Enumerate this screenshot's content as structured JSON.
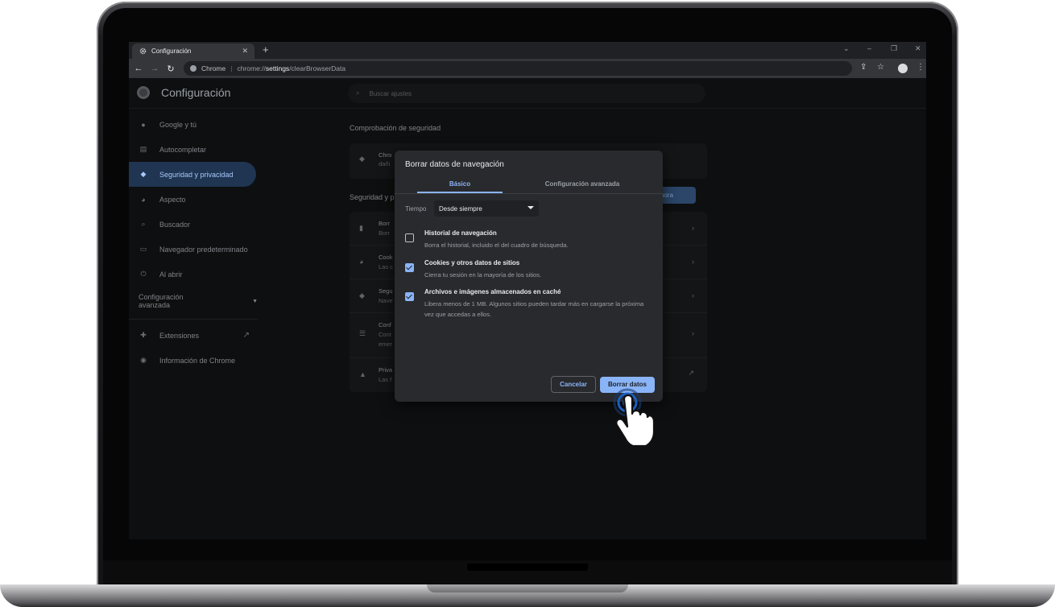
{
  "browser": {
    "tab_title": "Configuración",
    "tab_icon": "gear-icon",
    "tab_close": "✕",
    "new_tab": "+",
    "url_site": "Chrome",
    "url_scheme": "chrome://",
    "url_host": "settings",
    "url_path": "/clearBrowserData"
  },
  "settings": {
    "title": "Configuración",
    "search_placeholder": "Buscar ajustes",
    "nav": [
      {
        "label": "Google y tú",
        "icon": "person-icon"
      },
      {
        "label": "Autocompletar",
        "icon": "clipboard-icon"
      },
      {
        "label": "Seguridad y privacidad",
        "icon": "shield-icon"
      },
      {
        "label": "Aspecto",
        "icon": "palette-icon"
      },
      {
        "label": "Buscador",
        "icon": "search-icon"
      },
      {
        "label": "Navegador predeterminado",
        "icon": "browser-icon"
      },
      {
        "label": "Al abrir",
        "icon": "power-icon"
      }
    ],
    "advanced_label": "Configuración avanzada",
    "extensions_label": "Extensiones",
    "about_label": "Información de Chrome",
    "safety_title": "Comprobación de seguridad",
    "safety_row_title": "Chro",
    "safety_row_sub": "dañi",
    "safety_button": "ar ahora",
    "privacy_title": "Seguridad y p",
    "privacy_rows": [
      {
        "title": "Borr",
        "sub": "Borr"
      },
      {
        "title": "Cook",
        "sub": "Las c"
      },
      {
        "title": "Segu",
        "sub": "Nave"
      },
      {
        "title": "Conf",
        "sub": "Cont",
        "sub2": "emer"
      },
      {
        "title": "Priva",
        "sub": "Las f"
      }
    ]
  },
  "dialog": {
    "title": "Borrar datos de navegación",
    "tab_basic": "Básico",
    "tab_advanced": "Configuración avanzada",
    "time_label": "Tiempo",
    "time_value": "Desde siempre",
    "options": [
      {
        "title": "Historial de navegación",
        "desc": "Borra el historial, incluido el del cuadro de búsqueda.",
        "checked": false
      },
      {
        "title": "Cookies y otros datos de sitios",
        "desc": "Cierra tu sesión en la mayoría de los sitios.",
        "checked": true
      },
      {
        "title": "Archivos e imágenes almacenados en caché",
        "desc": "Libera menos de 1 MB. Algunos sitios pueden tardar más en cargarse la próxima vez que accedas a ellos.",
        "checked": true
      }
    ],
    "cancel_label": "Cancelar",
    "clear_label": "Borrar datos"
  },
  "colors": {
    "accent": "#8ab4f8",
    "active_nav": "#1f3552"
  }
}
